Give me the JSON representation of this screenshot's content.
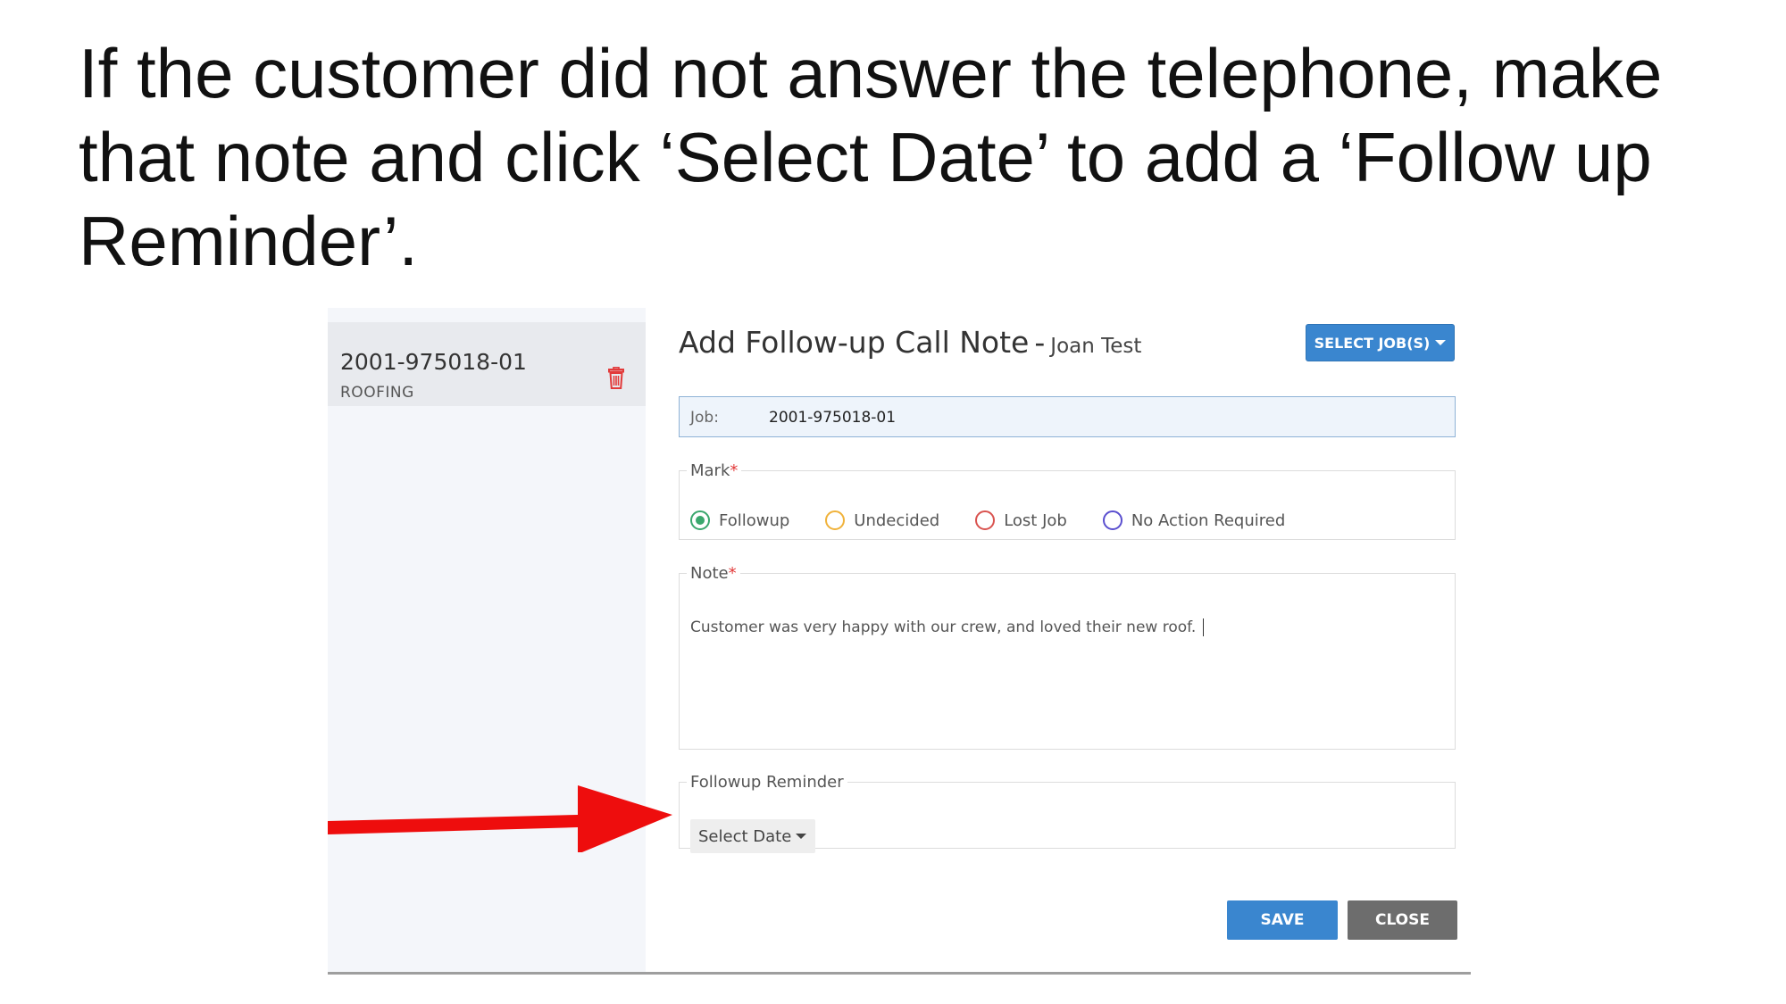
{
  "slide": {
    "instruction": "If the customer did not answer the telephone, make that note and click ‘Select Date’ to add a ‘Follow up Reminder’."
  },
  "sidebar": {
    "job_number": "2001-975018-01",
    "job_trade": "ROOFING",
    "delete_icon": "trash-icon"
  },
  "dialog": {
    "title": "Add Follow-up Call Note",
    "separator": "-",
    "customer_name": "Joan Test",
    "select_jobs_label": "SELECT JOB(S)",
    "job_label": "Job:",
    "job_value": "2001-975018-01",
    "mark_label": "Mark",
    "required_marker": "*",
    "mark_options": [
      {
        "label": "Followup",
        "color": "#3aa76d",
        "selected": true
      },
      {
        "label": "Undecided",
        "color": "#f0b23a",
        "selected": false
      },
      {
        "label": "Lost Job",
        "color": "#d9534f",
        "selected": false
      },
      {
        "label": "No Action Required",
        "color": "#5a4fcf",
        "selected": false
      }
    ],
    "note_label": "Note",
    "note_value": "Customer was very happy with our crew, and loved their new roof.",
    "reminder_label": "Followup Reminder",
    "select_date_label": "Select Date",
    "save_label": "SAVE",
    "close_label": "CLOSE"
  },
  "colors": {
    "primary": "#3a86cf",
    "close": "#6d6d6d",
    "arrow": "#ee0d0d",
    "required": "#e23a3a"
  }
}
